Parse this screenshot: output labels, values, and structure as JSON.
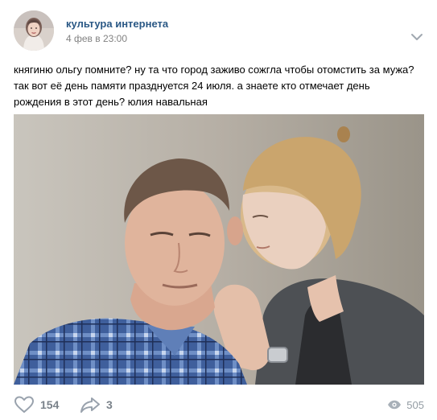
{
  "post": {
    "author": "культура интернета",
    "date": "4 фев в 23:00",
    "text": "княгиню ольгу помните? ну та что город заживо сожгла чтобы отомстить за мужа?\nтак вот её день памяти празднуется 24 июля. а знаете кто отмечает день\nрождения в этот день? юлия навальная",
    "photo_icon": "photo-of-man-and-woman-whispering"
  },
  "actions": {
    "likes": "154",
    "shares": "3",
    "views": "505"
  }
}
